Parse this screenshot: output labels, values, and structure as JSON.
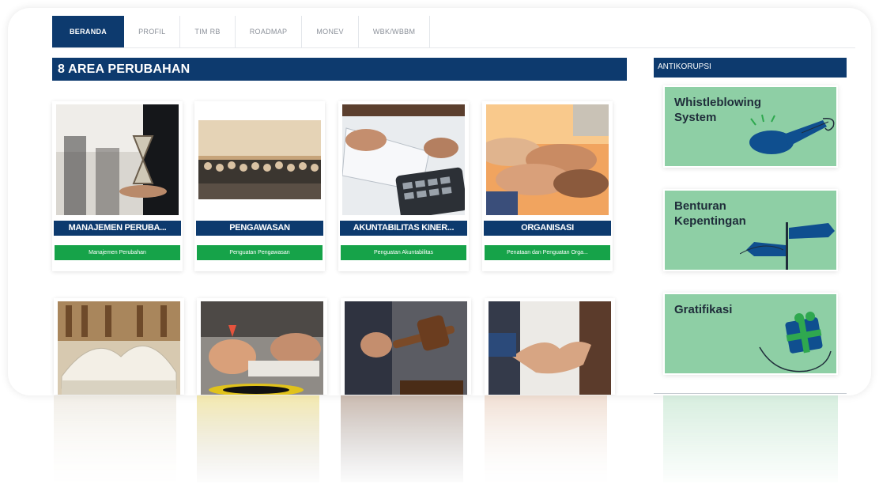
{
  "nav": {
    "items": [
      {
        "label": "BERANDA",
        "active": true
      },
      {
        "label": "PROFIL",
        "active": false
      },
      {
        "label": "TIM RB",
        "active": false
      },
      {
        "label": "ROADMAP",
        "active": false
      },
      {
        "label": "MONEV",
        "active": false
      },
      {
        "label": "WBK/WBBM",
        "active": false
      }
    ]
  },
  "main": {
    "section_title": "8 AREA PERUBAHAN",
    "cards": [
      {
        "title": "MANAJEMEN PERUBA...",
        "subtitle": "Manajemen Perubahan",
        "image": "hourglass-photo"
      },
      {
        "title": "PENGAWASAN",
        "subtitle": "Penguatan Pengawasan",
        "image": "group-photo"
      },
      {
        "title": "AKUNTABILITAS KINER...",
        "subtitle": "Penguatan Akuntabilitas",
        "image": "calculator-photo"
      },
      {
        "title": "ORGANISASI",
        "subtitle": "Penataan dan Penguatan Orga...",
        "image": "hands-photo"
      }
    ],
    "cards_row2": [
      {
        "image": "book-photo"
      },
      {
        "image": "dart-photo"
      },
      {
        "image": "gavel-photo"
      },
      {
        "image": "handshake-photo"
      }
    ]
  },
  "sidebar": {
    "title": "ANTIKORUPSI",
    "banners": [
      {
        "line1": "Whistleblowing",
        "line2": "System",
        "icon": "whistle-icon"
      },
      {
        "line1": "Benturan",
        "line2": "Kepentingan",
        "icon": "signpost-icon"
      },
      {
        "line1": "Gratifikasi",
        "line2": "",
        "icon": "gift-hand-icon"
      }
    ]
  },
  "colors": {
    "navy": "#0d3a6e",
    "green": "#16a349",
    "banner_green": "#8ecfa5"
  }
}
